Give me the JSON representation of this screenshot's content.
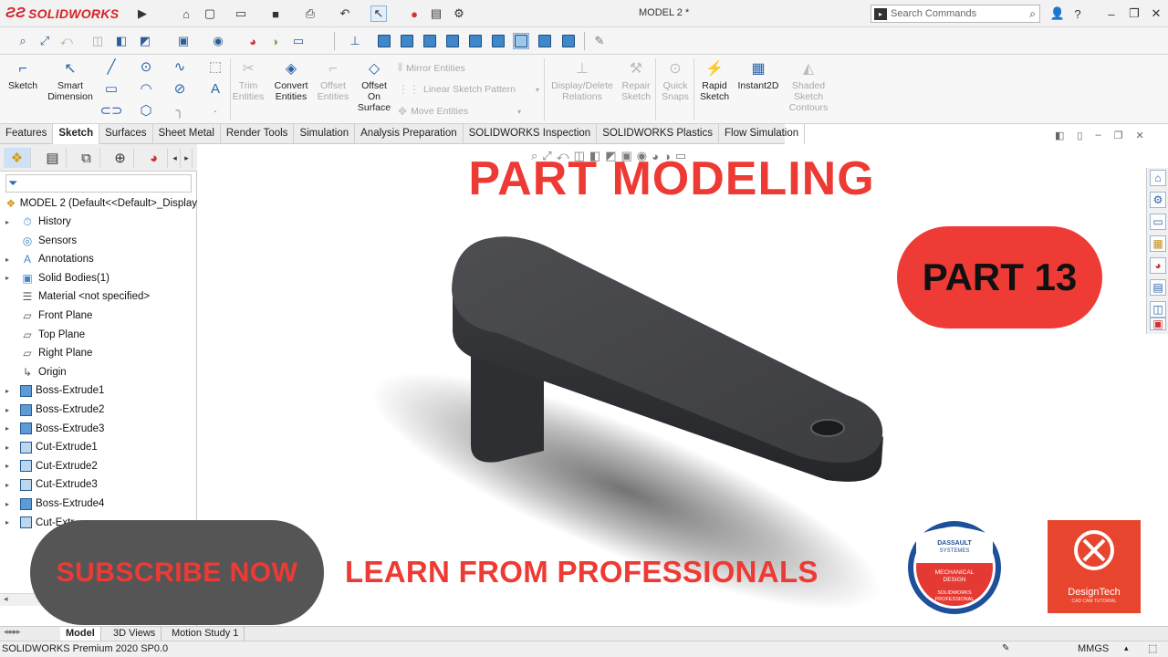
{
  "app": {
    "brand": "SOLIDWORKS",
    "document_title": "MODEL 2 *"
  },
  "search": {
    "placeholder": "Search Commands"
  },
  "command_manager": {
    "sketch": "Sketch",
    "smart_dimension": [
      "Smart",
      "Dimension"
    ],
    "trim_entities": [
      "Trim",
      "Entities"
    ],
    "convert_entities": [
      "Convert",
      "Entities"
    ],
    "offset_entities": [
      "Offset",
      "Entities"
    ],
    "offset_on_surface": [
      "Offset",
      "On",
      "Surface"
    ],
    "mirror_entities": "Mirror Entities",
    "linear_sketch_pattern": "Linear Sketch Pattern",
    "move_entities": "Move Entities",
    "display_delete_relations": [
      "Display/Delete",
      "Relations"
    ],
    "repair_sketch": [
      "Repair",
      "Sketch"
    ],
    "quick_snaps": [
      "Quick",
      "Snaps"
    ],
    "rapid_sketch": [
      "Rapid",
      "Sketch"
    ],
    "instant2d": "Instant2D",
    "shaded_sketch_contours": [
      "Shaded",
      "Sketch",
      "Contours"
    ]
  },
  "tabs": [
    "Features",
    "Sketch",
    "Surfaces",
    "Sheet Metal",
    "Render Tools",
    "Simulation",
    "Analysis Preparation",
    "SOLIDWORKS Inspection",
    "SOLIDWORKS Plastics",
    "Flow Simulation"
  ],
  "active_tab": "Sketch",
  "feature_tree": {
    "root": "MODEL 2  (Default<<Default>_Display",
    "items": [
      {
        "label": "History",
        "icon": "history-icon",
        "expandable": true
      },
      {
        "label": "Sensors",
        "icon": "sensors-icon",
        "expandable": false
      },
      {
        "label": "Annotations",
        "icon": "annotations-icon",
        "expandable": true
      },
      {
        "label": "Solid Bodies(1)",
        "icon": "solid-bodies-icon",
        "expandable": true
      },
      {
        "label": "Material <not specified>",
        "icon": "material-icon",
        "expandable": false
      },
      {
        "label": "Front Plane",
        "icon": "plane-icon",
        "expandable": false
      },
      {
        "label": "Top Plane",
        "icon": "plane-icon",
        "expandable": false
      },
      {
        "label": "Right Plane",
        "icon": "plane-icon",
        "expandable": false
      },
      {
        "label": "Origin",
        "icon": "origin-icon",
        "expandable": false
      },
      {
        "label": "Boss-Extrude1",
        "icon": "boss-extrude-icon",
        "expandable": true
      },
      {
        "label": "Boss-Extrude2",
        "icon": "boss-extrude-icon",
        "expandable": true
      },
      {
        "label": "Boss-Extrude3",
        "icon": "boss-extrude-icon",
        "expandable": true
      },
      {
        "label": "Cut-Extrude1",
        "icon": "cut-extrude-icon",
        "expandable": true
      },
      {
        "label": "Cut-Extrude2",
        "icon": "cut-extrude-icon",
        "expandable": true
      },
      {
        "label": "Cut-Extrude3",
        "icon": "cut-extrude-icon",
        "expandable": true
      },
      {
        "label": "Boss-Extrude4",
        "icon": "boss-extrude-icon",
        "expandable": true
      },
      {
        "label": "Cut-Extr",
        "icon": "cut-extrude-icon",
        "expandable": true
      }
    ]
  },
  "overlay": {
    "heading": "PART MODELING",
    "part_badge": "PART 13",
    "subscribe": "SUBSCRIBE NOW",
    "learn": "LEARN FROM PROFESSIONALS",
    "cert_badge": {
      "company": "DASSAULT SYSTEMES",
      "title": "MECHANICAL DESIGN",
      "ring": "SOLIDWORKS PROFESSIONAL"
    },
    "designtech": {
      "name": "DesignTech",
      "tagline": "CAD CAM TUTORIAL"
    },
    "accent_color": "#ee3a35"
  },
  "bottom_tabs": [
    "Model",
    "3D Views",
    "Motion Study 1"
  ],
  "active_bottom_tab": "Model",
  "status": {
    "version": "SOLIDWORKS Premium 2020 SP0.0",
    "units": "MMGS"
  }
}
